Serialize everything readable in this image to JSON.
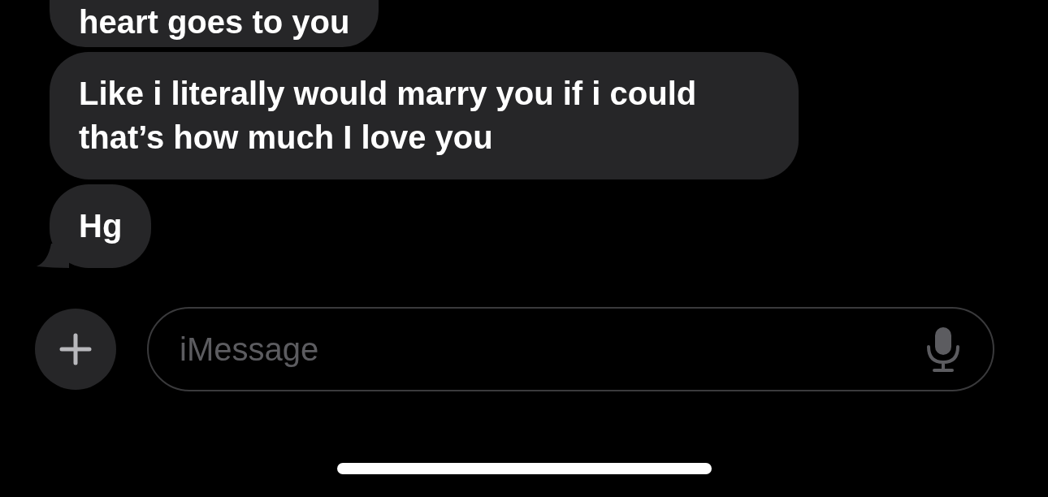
{
  "messages": [
    {
      "text": "heart goes to you",
      "clipped": true,
      "tail": false
    },
    {
      "text": "Like i literally would marry you if i could that’s how much I love you",
      "clipped": false,
      "tail": false
    },
    {
      "text": "Hg",
      "clipped": false,
      "tail": true
    }
  ],
  "composer": {
    "placeholder": "iMessage"
  }
}
